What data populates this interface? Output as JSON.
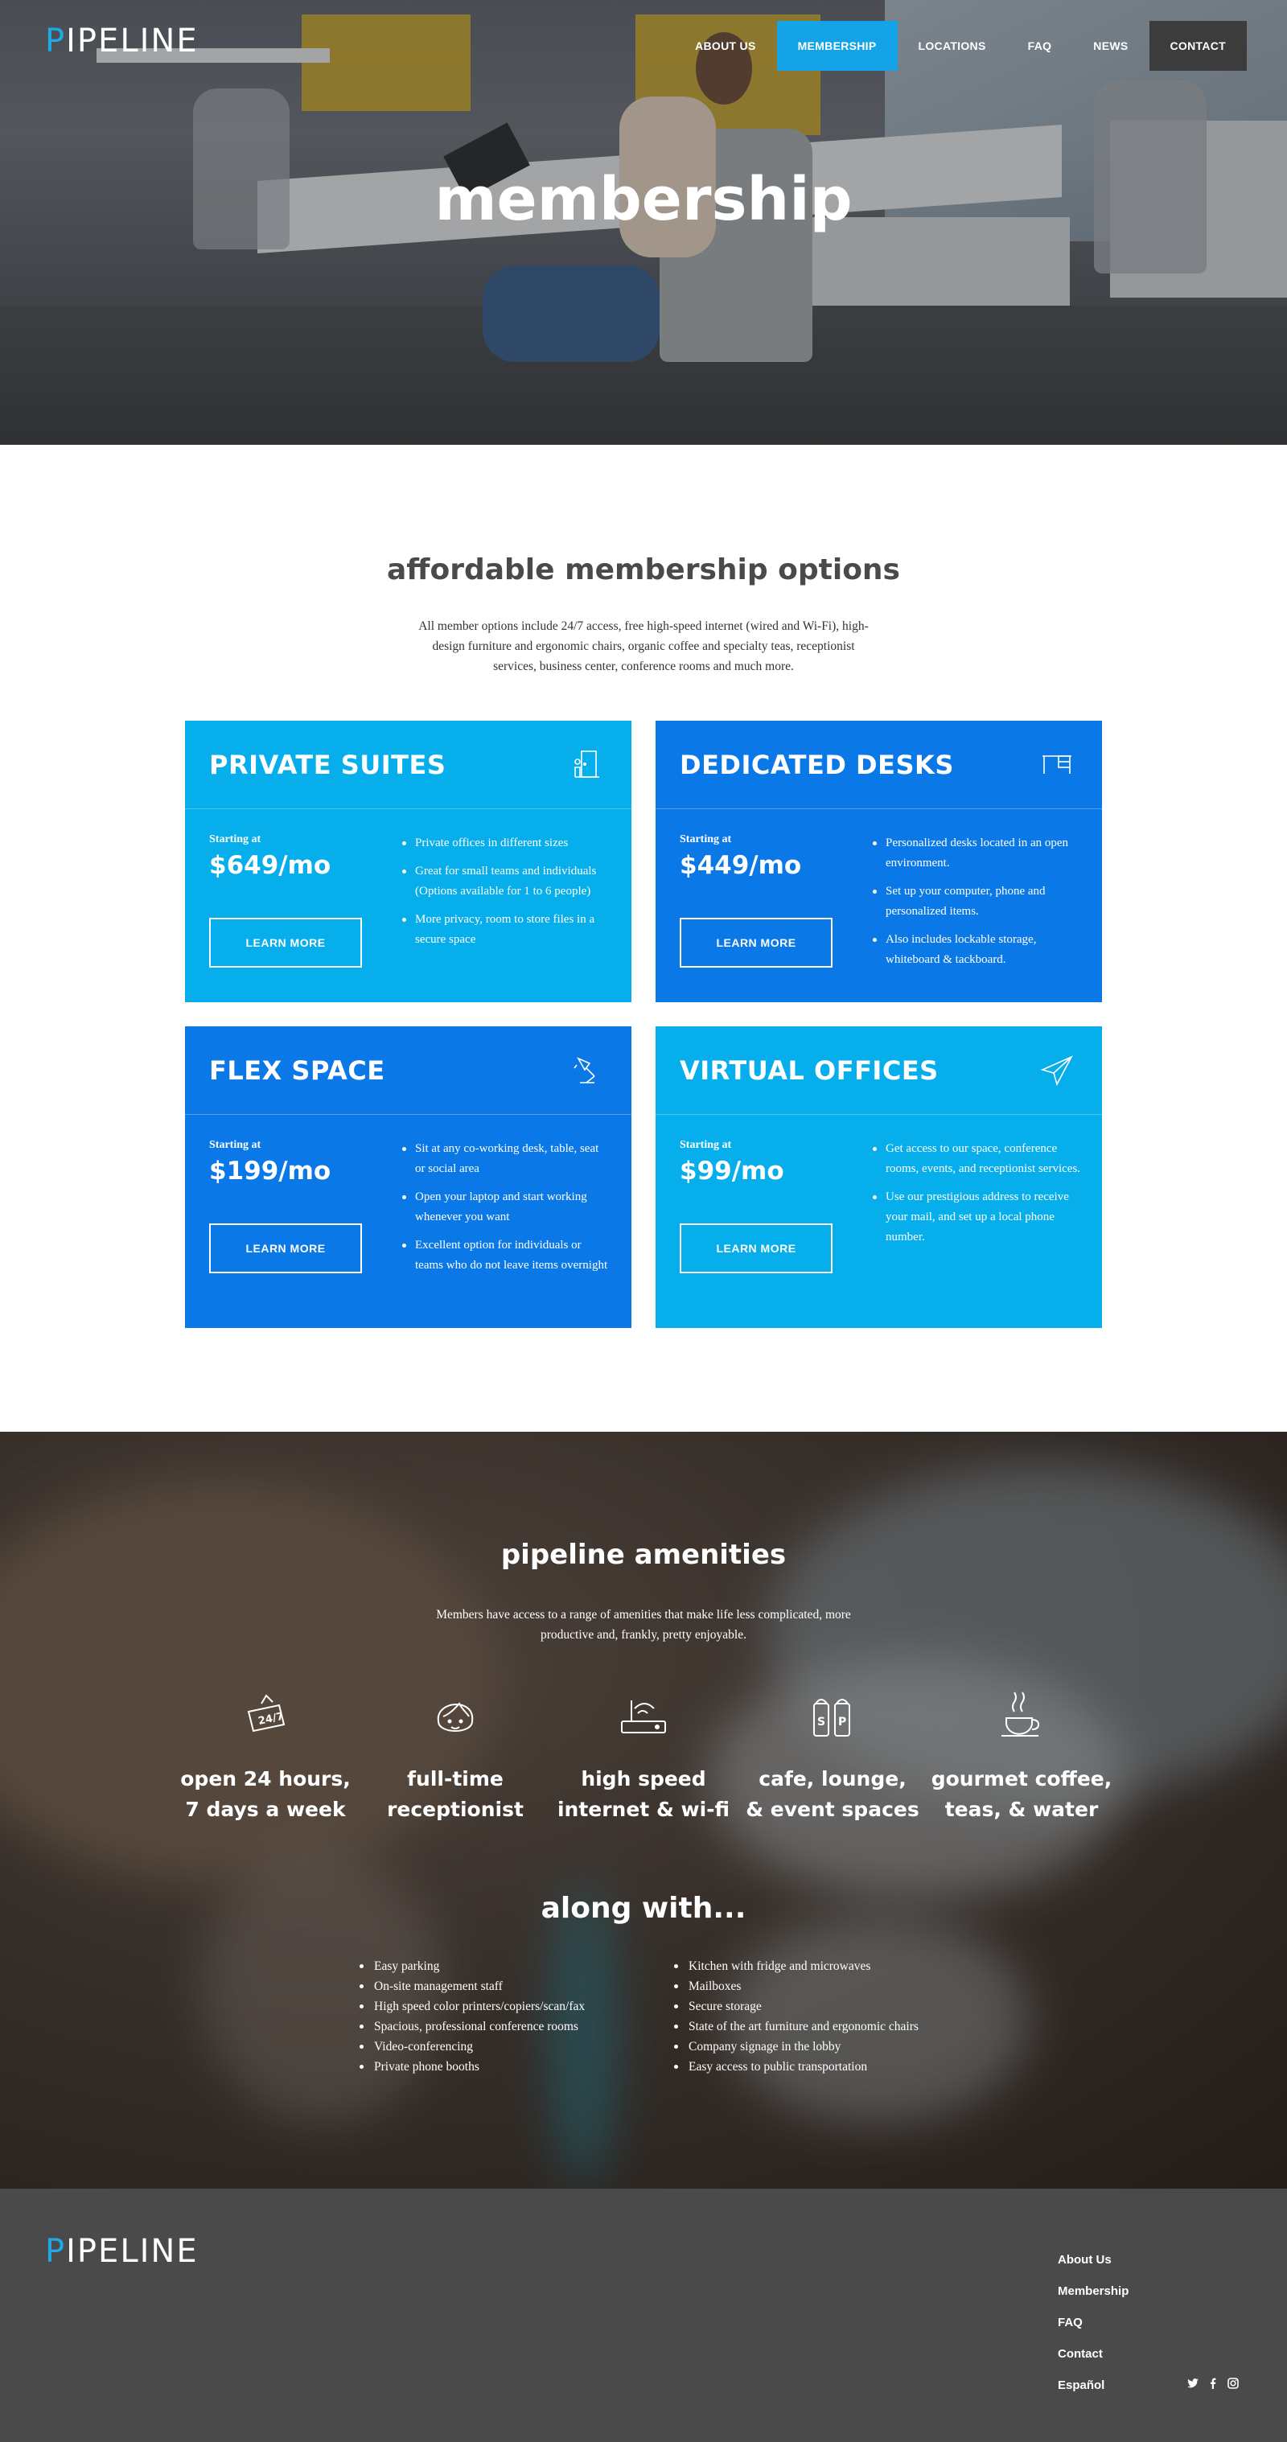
{
  "brand": {
    "logo_first": "P",
    "logo_rest": "IPELINE",
    "accent": "#13a3e6"
  },
  "nav": {
    "items": [
      {
        "label": "ABOUT US"
      },
      {
        "label": "MEMBERSHIP",
        "active": true
      },
      {
        "label": "LOCATIONS"
      },
      {
        "label": "FAQ"
      },
      {
        "label": "NEWS"
      },
      {
        "label": "CONTACT"
      }
    ]
  },
  "hero": {
    "title": "membership"
  },
  "membership": {
    "title": "affordable membership options",
    "intro": "All member options include 24/7 access, free high-speed internet (wired and Wi-Fi), high-design furniture and ergonomic chairs, organic coffee and specialty teas, receptionist services, business center, conference rooms and much more.",
    "cards": [
      {
        "title": "PRIVATE SUITES",
        "icon": "door-icon",
        "starting": "Starting at",
        "price": "$649/mo",
        "button": "LEARN MORE",
        "color": "#06aeeb",
        "features": [
          "Private offices in different sizes",
          "Great for small teams and individuals (Options available for 1 to 6 people)",
          "More privacy, room to store files in a secure space"
        ]
      },
      {
        "title": "DEDICATED DESKS",
        "icon": "desk-icon",
        "starting": "Starting at",
        "price": "$449/mo",
        "button": "LEARN MORE",
        "color": "#0b78e8",
        "features": [
          "Personalized desks located in an open environment.",
          "Set up your computer, phone and personalized items.",
          "Also includes lockable storage, whiteboard & tackboard."
        ]
      },
      {
        "title": "FLEX SPACE",
        "icon": "desk-lamp-icon",
        "starting": "Starting at",
        "price": "$199/mo",
        "button": "LEARN MORE",
        "color": "#0b78e8",
        "features": [
          "Sit at any co-working desk, table, seat or social area",
          "Open your laptop and start working whenever you want",
          "Excellent option for individuals or teams who do not leave items overnight"
        ]
      },
      {
        "title": "VIRTUAL OFFICES",
        "icon": "paper-plane-icon",
        "starting": "Starting at",
        "price": "$99/mo",
        "button": "LEARN MORE",
        "color": "#06aeeb",
        "features": [
          "Get access to our space, conference rooms, events, and receptionist services.",
          "Use our prestigious address to receive your mail, and set up a local phone number."
        ]
      }
    ]
  },
  "amenities": {
    "title": "pipeline amenities",
    "subtitle": "Members have access to a range of amenities that make life less complicated, more productive and, frankly, pretty enjoyable.",
    "items": [
      {
        "icon": "24-7-sign-icon",
        "line1": "open 24 hours,",
        "line2": "7 days a week"
      },
      {
        "icon": "receptionist-icon",
        "line1": "full-time",
        "line2": "receptionist"
      },
      {
        "icon": "router-icon",
        "line1": "high speed",
        "line2": "internet & wi-fi"
      },
      {
        "icon": "salt-pepper-icon",
        "line1": "cafe, lounge,",
        "line2": "& event spaces"
      },
      {
        "icon": "coffee-cup-icon",
        "line1": "gourmet coffee,",
        "line2": "teas, & water"
      }
    ],
    "along_title": "along with...",
    "along_left": [
      "Easy parking",
      "On-site management staff",
      "High speed color printers/copiers/scan/fax",
      "Spacious, professional conference rooms",
      "Video-conferencing",
      "Private phone booths"
    ],
    "along_right": [
      "Kitchen with fridge and microwaves",
      "Mailboxes",
      "Secure storage",
      "State of the art furniture and ergonomic chairs",
      "Company signage in the lobby",
      "Easy access to public transportation"
    ]
  },
  "footer": {
    "links": [
      "About Us",
      "Membership",
      "FAQ",
      "Contact",
      "Español"
    ],
    "social": [
      "twitter-icon",
      "facebook-icon",
      "instagram-icon"
    ]
  }
}
